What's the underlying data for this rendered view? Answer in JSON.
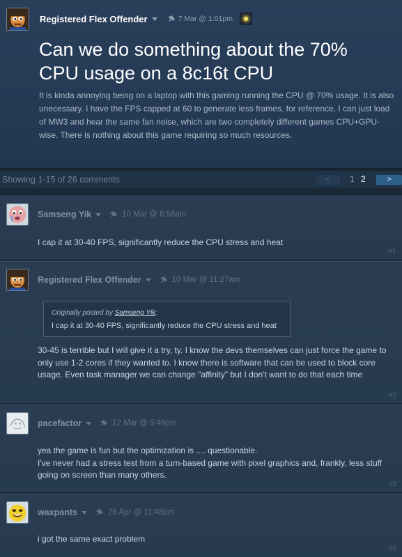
{
  "original_post": {
    "author": "Registered Flex Offender",
    "date": "7 Mar @ 1:01pm",
    "title": "Can we do something about the 70% CPU usage on a 8c16t CPU",
    "body": "It is kinda annoying being on a laptop with this gaming running the CPU @ 70% usage. It is also unecessary. I have the FPS capped at 60 to generate less frames. for reference, I can just load of MW3 and hear the same fan noise, which are two completely different games CPU+GPU-wise. There is nothing about this game requiring so much resources."
  },
  "paging": {
    "summary": "Showing 1-15 of 26 comments",
    "prev": "<",
    "pages": [
      "1",
      "2"
    ],
    "next": ">"
  },
  "comments": [
    {
      "author": "Samseng Yik",
      "date": "10 Mar @ 8:58am",
      "text": "I cap it at 30-40 FPS, significantly reduce the CPU stress and heat",
      "number": "#1"
    },
    {
      "author": "Registered Flex Offender",
      "date": "10 Mar @ 11:27am",
      "quote": {
        "prefix": "Originally posted by",
        "author": "Samseng Yik",
        "suffix": ":",
        "text": "I cap it at 30-40 FPS, significantly reduce the CPU stress and heat"
      },
      "text": "30-45 is terrible but I will give it a try, ty. I know the devs themselves can just force the game to only use 1-2 cores if they wanted to. I know there is software that can be used to block core usage. Even task manager we can change \"affinity\" but I don't want to do that each time",
      "number": "#2"
    },
    {
      "author": "pacefactor",
      "date": "12 Mar @ 5:49pm",
      "text_line1": "yea the game is fun but the optimization is .... questionable.",
      "text_line2": "I've never had a stress test from a turn-based game with pixel graphics and, frankly, less stuff going on screen than many others.",
      "number": "#3"
    },
    {
      "author": "waxpants",
      "date": "28 Apr @ 11:48pm",
      "text": "i got the same exact problem",
      "number": "#4"
    }
  ]
}
